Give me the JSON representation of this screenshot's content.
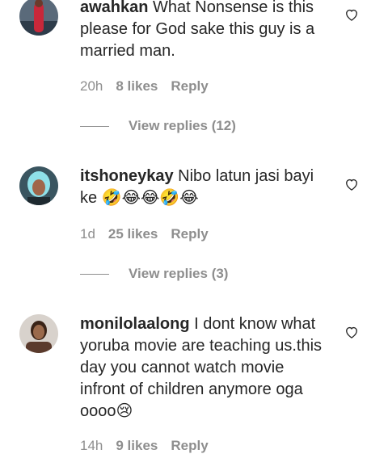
{
  "comments": [
    {
      "username": "awahkan",
      "text": "What Nonsense is this please for God sake this guy is a married man.",
      "time": "20h",
      "likes": "8 likes",
      "reply": "Reply",
      "view_replies": "View replies (12)"
    },
    {
      "username": "itshoneykay",
      "text": "Nibo latun jasi bayi ke 🤣😂😂🤣😂",
      "time": "1d",
      "likes": "25 likes",
      "reply": "Reply",
      "view_replies": "View replies (3)"
    },
    {
      "username": "monilolaalong",
      "text": "I dont know what yoruba movie are teaching us.this day you cannot watch movie infront of children anymore oga oooo😢",
      "time": "14h",
      "likes": "9 likes",
      "reply": "Reply"
    }
  ],
  "icons": {
    "like": "heart-outline-icon"
  },
  "colors": {
    "primary_text": "#262626",
    "secondary_text": "#8e8e8e"
  }
}
